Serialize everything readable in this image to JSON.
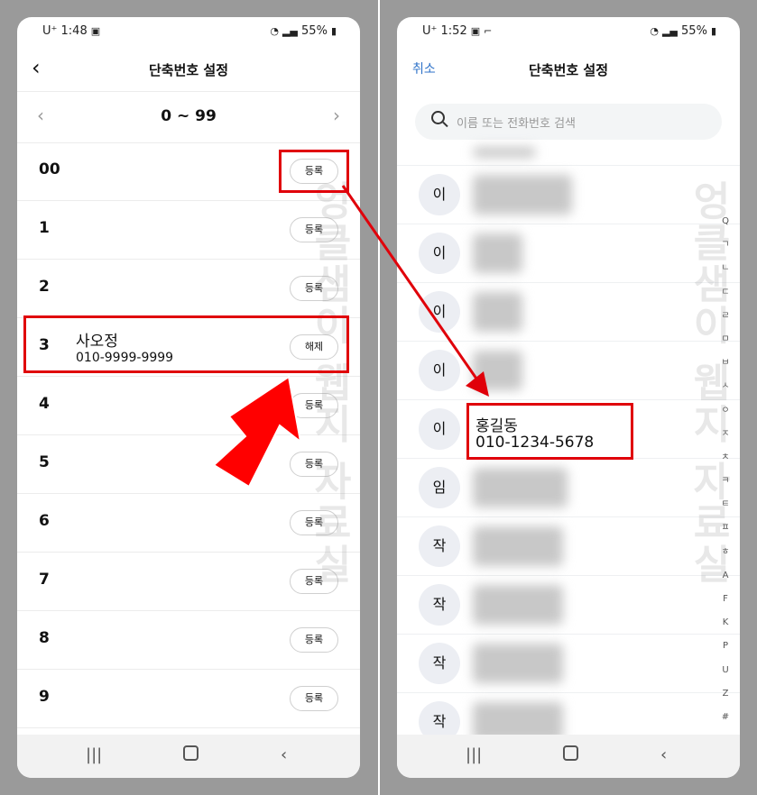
{
  "left": {
    "status": {
      "carrier": "U⁺",
      "time": "1:48",
      "battery": "55%"
    },
    "title": "단축번호 설정",
    "range_label": "0 ~ 99",
    "rows": [
      {
        "num": "00",
        "name": "",
        "phone": "",
        "action": "등록"
      },
      {
        "num": "1",
        "name": "",
        "phone": "",
        "action": "등록"
      },
      {
        "num": "2",
        "name": "",
        "phone": "",
        "action": "등록"
      },
      {
        "num": "3",
        "name": "사오정",
        "phone": "010-9999-9999",
        "action": "해제"
      },
      {
        "num": "4",
        "name": "",
        "phone": "",
        "action": "등록"
      },
      {
        "num": "5",
        "name": "",
        "phone": "",
        "action": "등록"
      },
      {
        "num": "6",
        "name": "",
        "phone": "",
        "action": "등록"
      },
      {
        "num": "7",
        "name": "",
        "phone": "",
        "action": "등록"
      },
      {
        "num": "8",
        "name": "",
        "phone": "",
        "action": "등록"
      },
      {
        "num": "9",
        "name": "",
        "phone": "",
        "action": "등록"
      }
    ]
  },
  "right": {
    "status": {
      "carrier": "U⁺",
      "time": "1:52",
      "battery": "55%"
    },
    "title": "단축번호 설정",
    "cancel": "취소",
    "search_placeholder": "이름 또는 전화번호 검색",
    "contacts": [
      {
        "initial": "이",
        "name": "",
        "phone": ""
      },
      {
        "initial": "이",
        "name": "",
        "phone": ""
      },
      {
        "initial": "이",
        "name": "",
        "phone": ""
      },
      {
        "initial": "이",
        "name": "",
        "phone": ""
      },
      {
        "initial": "이",
        "name": "홍길동",
        "phone": "010-1234-5678"
      },
      {
        "initial": "임",
        "name": "",
        "phone": ""
      },
      {
        "initial": "작",
        "name": "",
        "phone": ""
      },
      {
        "initial": "작",
        "name": "",
        "phone": ""
      },
      {
        "initial": "작",
        "name": "",
        "phone": ""
      },
      {
        "initial": "작",
        "name": "",
        "phone": ""
      }
    ],
    "index": [
      "Q",
      "ㄱ",
      "ㄴ",
      "ㄷ",
      "ㄹ",
      "ㅁ",
      "ㅂ",
      "ㅅ",
      "ㅇ",
      "ㅈ",
      "ㅊ",
      "ㅋ",
      "ㅌ",
      "ㅍ",
      "ㅎ",
      "A",
      "F",
      "K",
      "P",
      "U",
      "Z",
      "#"
    ]
  },
  "watermark": "엉클샘이 웹지 자료실",
  "colors": {
    "highlight": "#e0000a",
    "link": "#2f73c9"
  }
}
